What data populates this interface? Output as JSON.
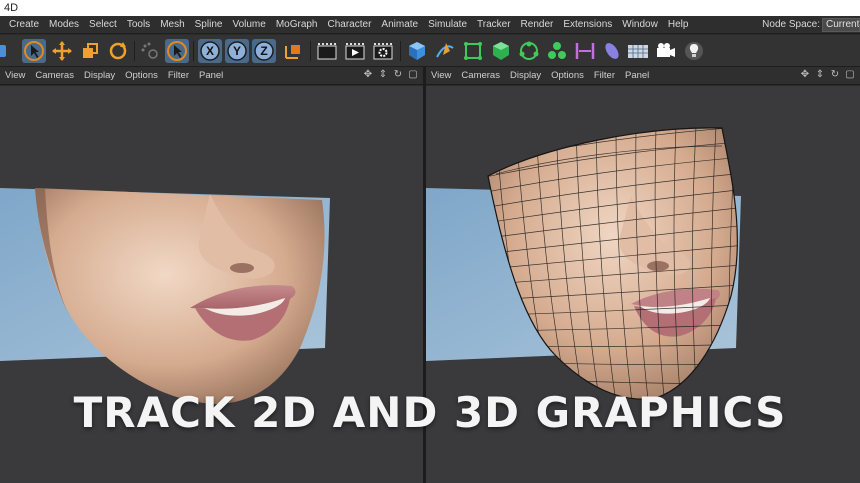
{
  "window": {
    "title": "4D"
  },
  "menubar": {
    "items": [
      "Create",
      "Modes",
      "Select",
      "Tools",
      "Mesh",
      "Spline",
      "Volume",
      "MoGraph",
      "Character",
      "Animate",
      "Simulate",
      "Tracker",
      "Render",
      "Extensions",
      "Window",
      "Help"
    ],
    "node_space_label": "Node Space:",
    "node_space_value": "Current"
  },
  "toolbar": {
    "icons": [
      "selection-cursor",
      "move",
      "scale",
      "rotate",
      "live-selection",
      "x-axis",
      "y-axis",
      "z-axis",
      "coordinate-system",
      "render-view",
      "render-picture-viewer",
      "render-settings",
      "cube",
      "pen",
      "subdivision-surface",
      "extrude",
      "cloner",
      "connect",
      "symmetry",
      "deformer",
      "floor",
      "camera",
      "light"
    ],
    "axis_labels": [
      "X",
      "Y",
      "Z"
    ]
  },
  "viewports": {
    "left": {
      "menu": [
        "View",
        "Cameras",
        "Display",
        "Options",
        "Filter",
        "Panel"
      ]
    },
    "right": {
      "menu": [
        "View",
        "Cameras",
        "Display",
        "Options",
        "Filter",
        "Panel"
      ]
    }
  },
  "caption": "TRACK 2D AND 3D GRAPHICS",
  "colors": {
    "accent": "#4a90d9",
    "viewport_bg": "#3a3a3c",
    "caption": "#f4f4f4"
  }
}
